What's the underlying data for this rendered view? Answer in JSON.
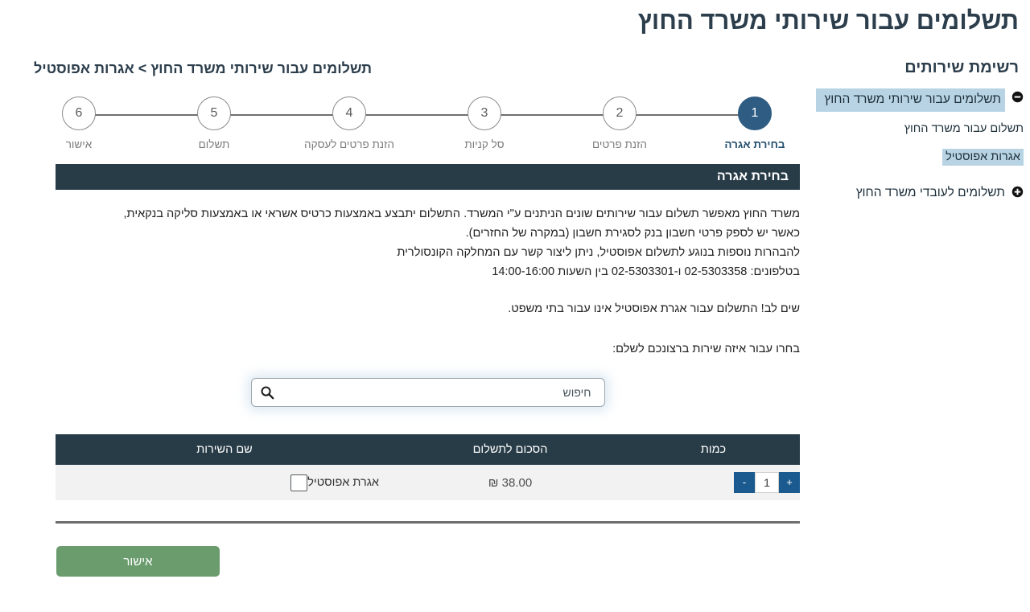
{
  "page": {
    "title": "תשלומים עבור שירותי משרד החוץ",
    "breadcrumb": "תשלומים עבור שירותי משרד החוץ > אגרות אפוסטיל",
    "section_header": "בחירת אגרה"
  },
  "colors": {
    "header_navy": "#283c48",
    "active_step": "#2e5c82",
    "highlight_blue": "#b8d4e4",
    "confirm_green": "#6a9c6d",
    "qty_button_blue": "#1b5a8e"
  },
  "sidebar": {
    "title": "רשימת שירותים",
    "nodes": [
      {
        "label": "תשלומים עבור שירותי משרד החוץ",
        "toggle": "minus-circle-icon",
        "expanded": true,
        "children": [
          {
            "label": "תשלום עבור משרד החוץ",
            "active": false
          },
          {
            "label": "אגרות אפוסטיל",
            "active": true
          }
        ]
      },
      {
        "label": "תשלומים לעובדי משרד החוץ",
        "toggle": "plus-circle-icon",
        "expanded": false,
        "children": []
      }
    ]
  },
  "stepper": {
    "steps": [
      {
        "number": "6",
        "label": "אישור",
        "active": false
      },
      {
        "number": "5",
        "label": "תשלום",
        "active": false
      },
      {
        "number": "4",
        "label": "הזנת פרטים לעסקה",
        "active": false
      },
      {
        "number": "3",
        "label": "סל קניות",
        "active": false
      },
      {
        "number": "2",
        "label": "הזנת פרטים",
        "active": false
      },
      {
        "number": "1",
        "label": "בחירת אגרה",
        "active": true
      }
    ]
  },
  "body": {
    "paragraph1_line1": "משרד החוץ מאפשר תשלום עבור שירותים שונים הניתנים ע\"י המשרד. התשלום יתבצע באמצעות כרטיס אשראי או באמצעות סליקה בנקאית,",
    "paragraph1_line2": "כאשר יש לספק פרטי חשבון בנק לסגירת חשבון (במקרה של החזרים).",
    "paragraph2_line1": "להבהרות נוספות בנוגע לתשלום אפוסטיל, ניתן ליצור קשר עם המחלקה הקונסולרית",
    "paragraph2_line2": "בטלפונים: 02-5303358 ו-02-5303301 בין השעות 14:00-16:00",
    "notice": "שים לב! התשלום עבור אגרת אפוסטיל אינו עבור בתי משפט.",
    "prompt": "בחרו עבור איזה שירות ברצונכם לשלם:"
  },
  "search": {
    "placeholder": "חיפוש",
    "value": "",
    "icon": "search-icon"
  },
  "table": {
    "columns": {
      "service": "שם השירות",
      "amount": "הסכום לתשלום",
      "quantity": "כמות"
    },
    "rows": [
      {
        "checked": false,
        "service": "אגרת אפוסטיל",
        "amount": "38.00 ₪",
        "quantity": "1",
        "increment_label": "+",
        "decrement_label": "-"
      }
    ]
  },
  "footer": {
    "confirm_label": "אישור"
  }
}
